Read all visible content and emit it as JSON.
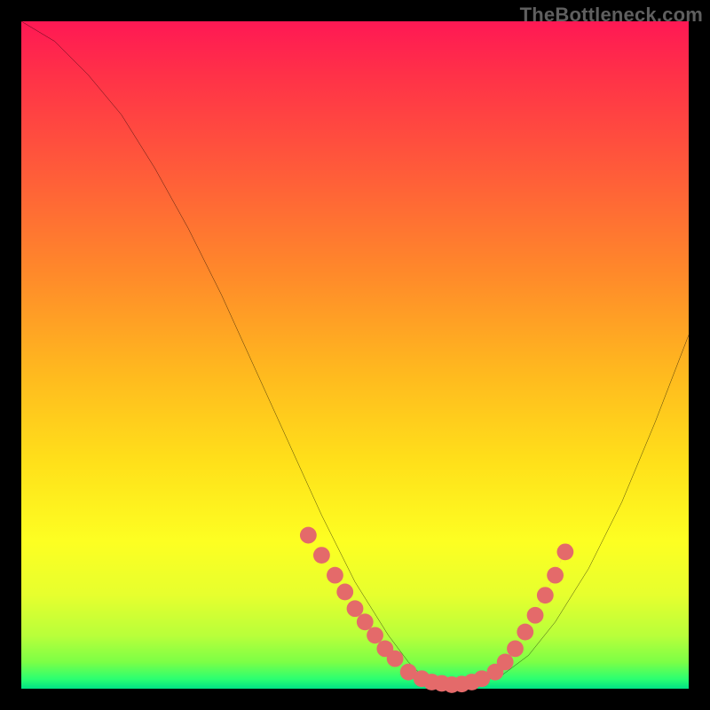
{
  "watermark": {
    "text": "TheBottleneck.com"
  },
  "chart_data": {
    "type": "line",
    "title": "",
    "xlabel": "",
    "ylabel": "",
    "xlim": [
      0,
      100
    ],
    "ylim": [
      0,
      100
    ],
    "grid": false,
    "legend": false,
    "series": [
      {
        "name": "curve",
        "x": [
          0,
          5,
          10,
          15,
          20,
          25,
          30,
          35,
          40,
          45,
          50,
          55,
          58,
          60,
          62,
          65,
          68,
          72,
          76,
          80,
          85,
          90,
          95,
          100
        ],
        "y": [
          100,
          97,
          92,
          86,
          78,
          69,
          59,
          48,
          37,
          26,
          16,
          8,
          4,
          2,
          1,
          0.5,
          0.8,
          2,
          5,
          10,
          18,
          28,
          40,
          53
        ]
      }
    ],
    "markers": [
      {
        "name": "left-cluster",
        "color": "#e46a6a",
        "points": [
          {
            "x": 43,
            "y": 23
          },
          {
            "x": 45,
            "y": 20
          },
          {
            "x": 47,
            "y": 17
          },
          {
            "x": 48.5,
            "y": 14.5
          },
          {
            "x": 50,
            "y": 12
          },
          {
            "x": 51.5,
            "y": 10
          },
          {
            "x": 53,
            "y": 8
          },
          {
            "x": 54.5,
            "y": 6
          },
          {
            "x": 56,
            "y": 4.5
          }
        ]
      },
      {
        "name": "bottom-cluster",
        "color": "#e46a6a",
        "points": [
          {
            "x": 58,
            "y": 2.5
          },
          {
            "x": 60,
            "y": 1.5
          },
          {
            "x": 61.5,
            "y": 1
          },
          {
            "x": 63,
            "y": 0.8
          },
          {
            "x": 64.5,
            "y": 0.6
          },
          {
            "x": 66,
            "y": 0.7
          },
          {
            "x": 67.5,
            "y": 1
          },
          {
            "x": 69,
            "y": 1.5
          }
        ]
      },
      {
        "name": "right-cluster",
        "color": "#e46a6a",
        "points": [
          {
            "x": 71,
            "y": 2.5
          },
          {
            "x": 72.5,
            "y": 4
          },
          {
            "x": 74,
            "y": 6
          },
          {
            "x": 75.5,
            "y": 8.5
          },
          {
            "x": 77,
            "y": 11
          },
          {
            "x": 78.5,
            "y": 14
          },
          {
            "x": 80,
            "y": 17
          },
          {
            "x": 81.5,
            "y": 20.5
          }
        ]
      }
    ],
    "ticks_right": [
      {
        "x": 77,
        "y": 11.5
      },
      {
        "x": 77.8,
        "y": 13
      },
      {
        "x": 78.6,
        "y": 14.5
      },
      {
        "x": 79.4,
        "y": 16
      },
      {
        "x": 80.2,
        "y": 17.8
      },
      {
        "x": 81.0,
        "y": 19.5
      },
      {
        "x": 81.8,
        "y": 21.2
      }
    ]
  }
}
